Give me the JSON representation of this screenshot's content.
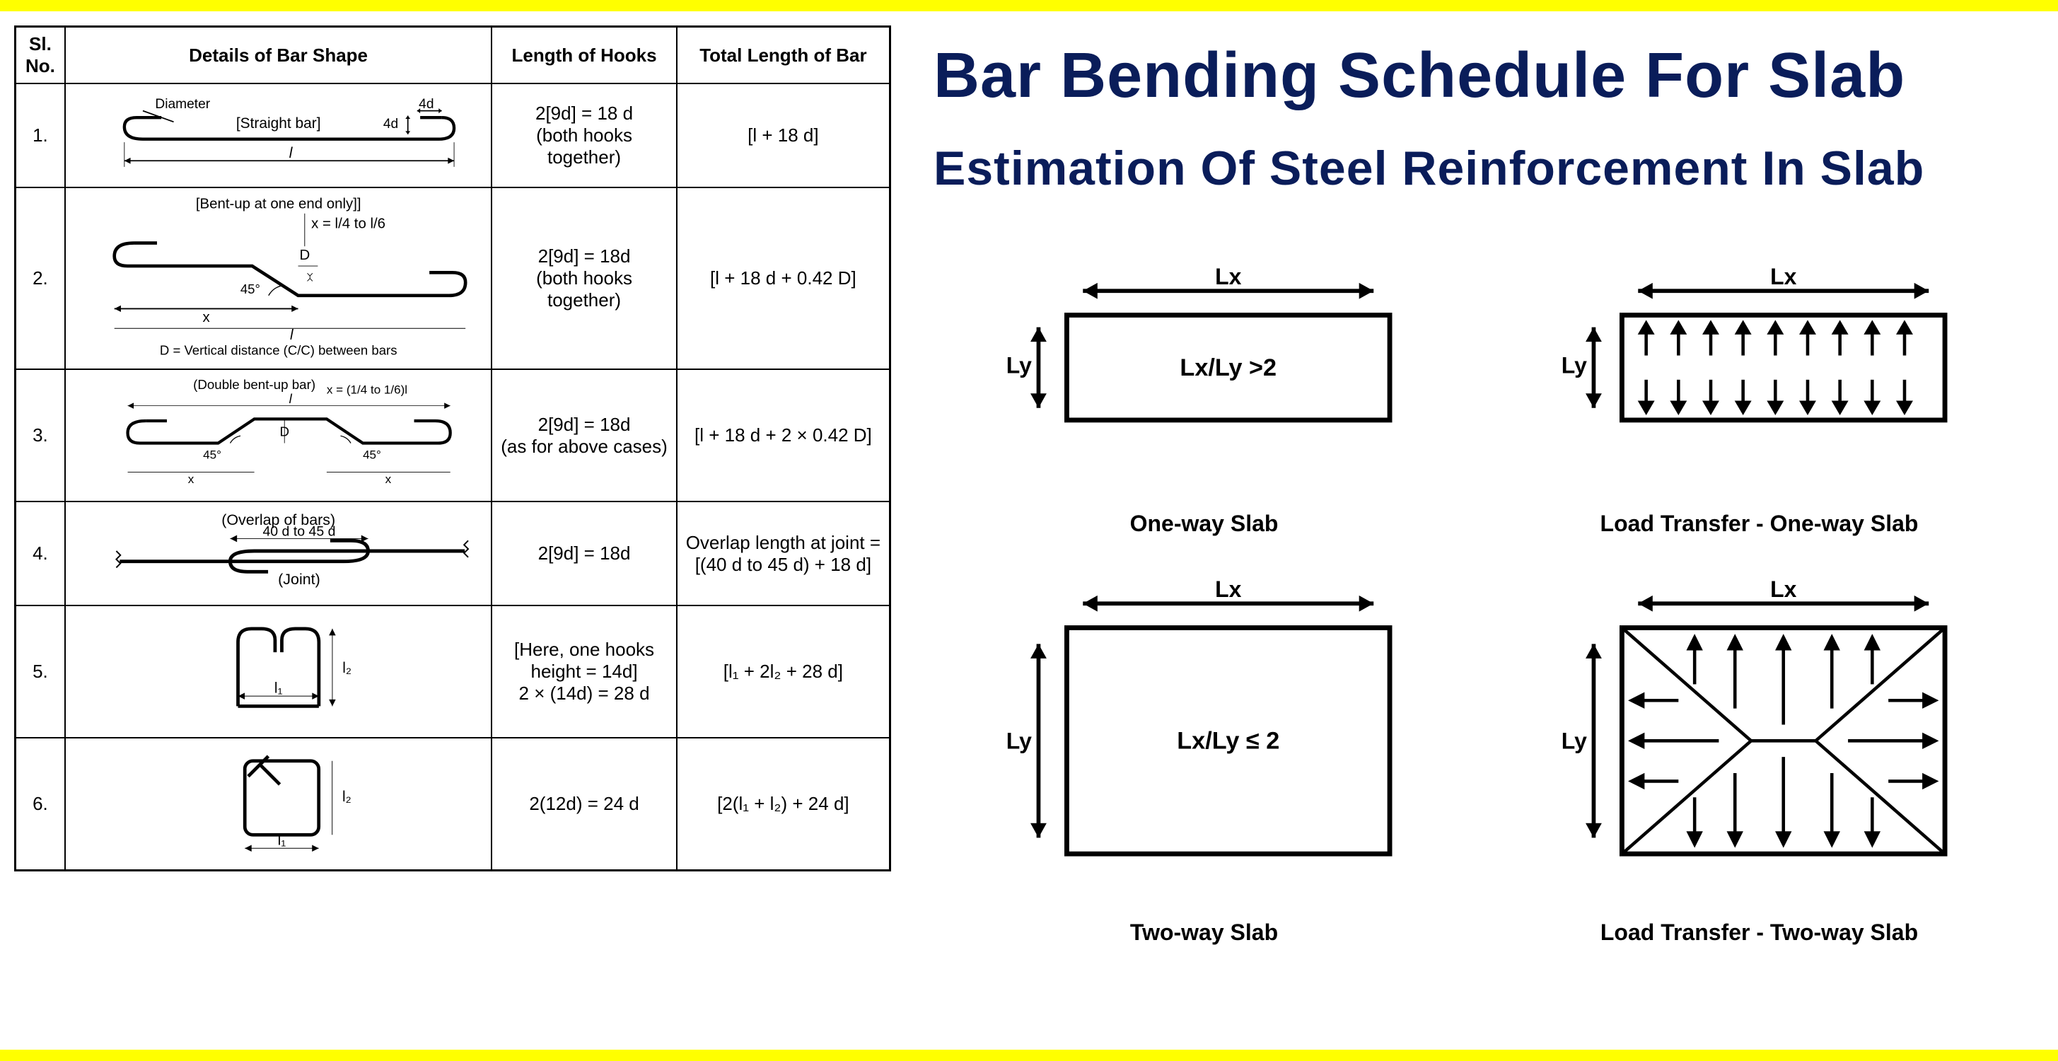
{
  "table": {
    "headers": {
      "sl": "Sl. No.",
      "details": "Details of Bar Shape",
      "hooks": "Length of Hooks",
      "total": "Total Length of Bar"
    },
    "rows": [
      {
        "no": "1.",
        "title": "[Straight bar]",
        "labels": {
          "diameter": "Diameter",
          "4d_top": "4d",
          "4d_side": "4d",
          "l": "l"
        },
        "hooks": "2[9d] = 18 d\n(both hooks together)",
        "total": "[l + 18 d]"
      },
      {
        "no": "2.",
        "title": "[Bent-up at one end only]]",
        "labels": {
          "x_formula": "x = l/4 to l/6",
          "D": "D",
          "angle": "45°",
          "x": "x",
          "l": "l",
          "note": "D = Vertical distance (C/C) between bars"
        },
        "hooks": "2[9d] = 18d\n(both hooks together)",
        "total": "[l + 18 d + 0.42 D]"
      },
      {
        "no": "3.",
        "title": "(Double bent-up bar)",
        "labels": {
          "x_formula": "x = (1/4 to 1/6)l",
          "D": "D",
          "angle_l": "45°",
          "angle_r": "45°",
          "x": "x",
          "l": "l"
        },
        "hooks": "2[9d] = 18d\n(as for above cases)",
        "total": "[l + 18 d + 2 × 0.42 D]"
      },
      {
        "no": "4.",
        "title": "(Overlap of bars)",
        "labels": {
          "overlap": "40 d to 45 d",
          "joint": "(Joint)"
        },
        "hooks": "2[9d] = 18d",
        "total": "Overlap length at joint = [(40 d to 45 d) + 18 d]"
      },
      {
        "no": "5.",
        "title": "",
        "labels": {
          "l1": "l₁",
          "l2": "l₂"
        },
        "hooks": "[Here, one hooks height = 14d]\n2 × (14d) = 28 d",
        "total": "[l₁ + 2l₂ + 28 d]"
      },
      {
        "no": "6.",
        "title": "",
        "labels": {
          "l1": "l₁",
          "l2": "l₂"
        },
        "hooks": "2(12d) = 24 d",
        "total": "[2(l₁ + l₂) + 24 d]"
      }
    ]
  },
  "titles": {
    "main": "Bar Bending Schedule For Slab",
    "sub": "Estimation Of Steel Reinforcement In Slab"
  },
  "slabs": {
    "dims": {
      "lx": "Lx",
      "ly": "Ly"
    },
    "oneway": {
      "ratio": "Lx/Ly >2",
      "label": "One-way Slab"
    },
    "oneway_load": {
      "label": "Load Transfer - One-way Slab"
    },
    "twoway": {
      "ratio": "Lx/Ly ≤ 2",
      "label": "Two-way Slab"
    },
    "twoway_load": {
      "label": "Load Transfer -  Two-way Slab"
    }
  }
}
